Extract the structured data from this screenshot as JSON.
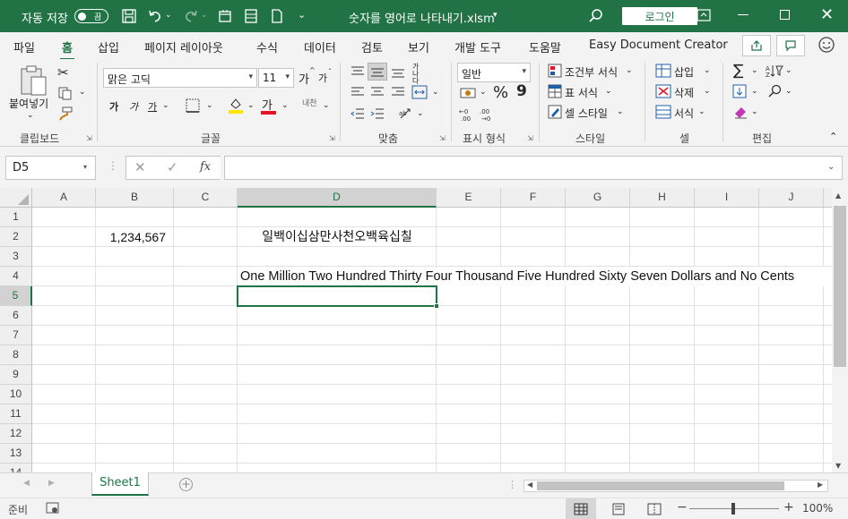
{
  "titlebar": {
    "autosave_label": "자동 저장",
    "autosave_state": "끔",
    "filename": "숫자를 영어로 나타내기.xlsm",
    "login_button": "로그인"
  },
  "tabs": [
    {
      "label": "파일"
    },
    {
      "label": "홈"
    },
    {
      "label": "삽입"
    },
    {
      "label": "페이지 레이아웃"
    },
    {
      "label": "수식"
    },
    {
      "label": "데이터"
    },
    {
      "label": "검토"
    },
    {
      "label": "보기"
    },
    {
      "label": "개발 도구"
    },
    {
      "label": "도움말"
    },
    {
      "label": "Easy Document Creator"
    }
  ],
  "ribbon": {
    "clipboard": {
      "paste": "붙여넣기",
      "group": "클립보드"
    },
    "font": {
      "name": "맑은 고딕",
      "size": "11",
      "grow": "가",
      "shrink": "가",
      "bold": "가",
      "italic": "가",
      "underline": "가",
      "font_color": "가",
      "phonetic": "내천",
      "group": "글꼴"
    },
    "alignment": {
      "wrap": "가나다",
      "group": "맞춤"
    },
    "number": {
      "format": "일반",
      "percent": "%",
      "comma": "9",
      "group": "표시 형식"
    },
    "styles": {
      "conditional": "조건부 서식",
      "table": "표 서식",
      "cell": "셀 스타일",
      "group": "스타일"
    },
    "cells": {
      "insert": "삽입",
      "delete": "삭제",
      "format": "서식",
      "group": "셀"
    },
    "editing": {
      "group": "편집"
    }
  },
  "formula_bar": {
    "name_box": "D5",
    "fx": "fx",
    "formula": ""
  },
  "columns": [
    "A",
    "B",
    "C",
    "D",
    "E",
    "F",
    "G",
    "H",
    "I",
    "J"
  ],
  "rows": [
    "1",
    "2",
    "3",
    "4",
    "5",
    "6",
    "7",
    "8",
    "9",
    "10",
    "11",
    "12",
    "13",
    "14"
  ],
  "cells": {
    "B2": "1,234,567",
    "D2": "일백이십삼만사천오백육십칠",
    "D4": "One Million Two Hundred Thirty Four Thousand Five Hundred Sixty Seven Dollars and No Cents"
  },
  "sheet_tabs": [
    {
      "label": "Sheet1"
    }
  ],
  "statusbar": {
    "ready": "준비",
    "zoom": "100%"
  },
  "colors": {
    "brand": "#217346",
    "selection": "#217346"
  }
}
